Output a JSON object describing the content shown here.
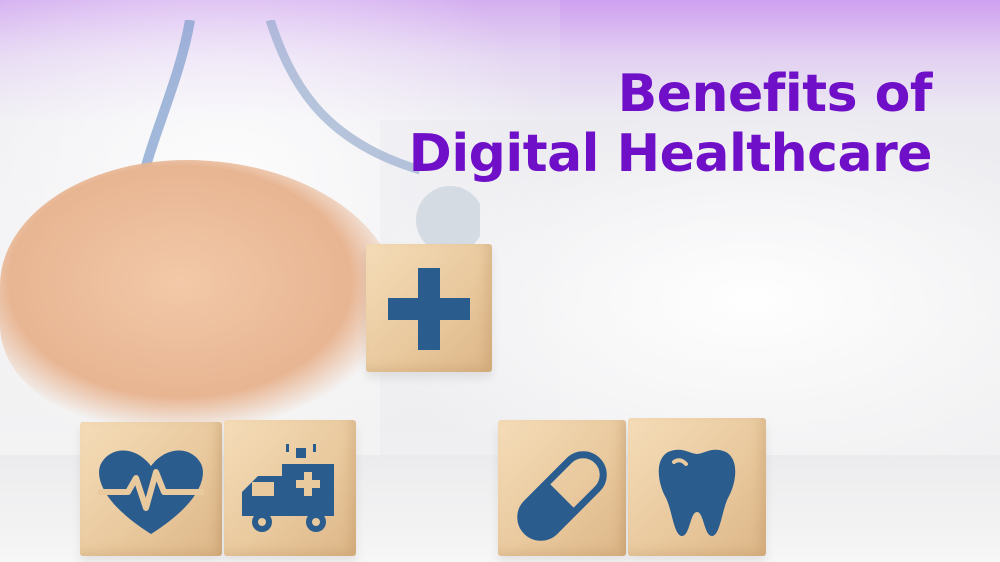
{
  "headline": {
    "line1": "Benefits of",
    "line2": "Digital Healthcare"
  },
  "colors": {
    "headline": "#6f0fc7",
    "icon": "#2a5c8e",
    "wood": "#e9c99e",
    "top_gradient": "#cfa0f0"
  },
  "blocks": [
    {
      "icon": "medical-cross-icon"
    },
    {
      "icon": "heartbeat-icon"
    },
    {
      "icon": "ambulance-icon"
    },
    {
      "icon": "pill-capsule-icon"
    },
    {
      "icon": "tooth-icon"
    }
  ]
}
